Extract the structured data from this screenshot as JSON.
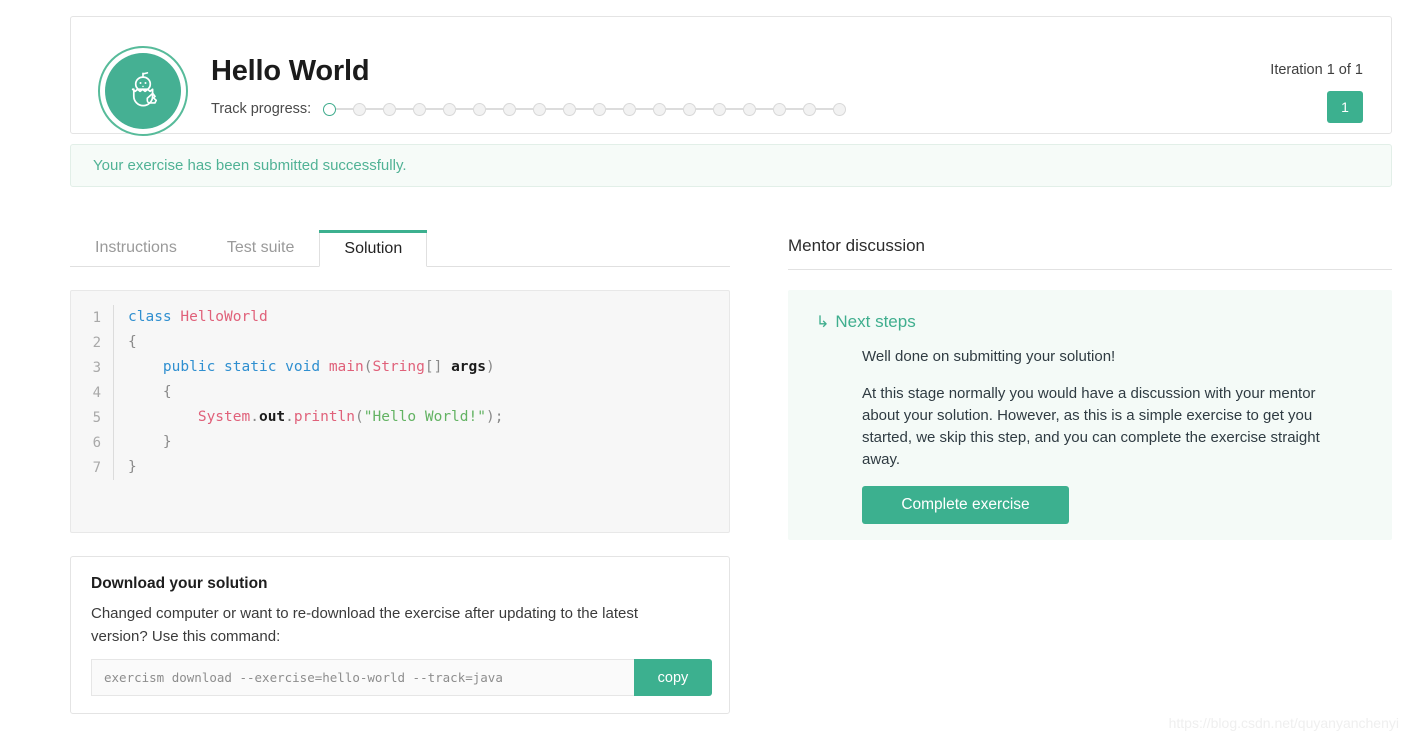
{
  "header": {
    "logo_icon": "hatching-chick-icon",
    "title": "Hello World",
    "track_progress_label": "Track progress:",
    "progress_total_dots": 18,
    "progress_completed_dots": 1,
    "iteration_label": "Iteration 1 of 1",
    "iteration_badge": "1"
  },
  "flash": {
    "message": "Your exercise has been submitted successfully."
  },
  "tabs": [
    {
      "label": "Instructions",
      "active": false
    },
    {
      "label": "Test suite",
      "active": false
    },
    {
      "label": "Solution",
      "active": true
    }
  ],
  "code": {
    "language": "java",
    "lines": [
      {
        "num": "1",
        "text": "class HelloWorld"
      },
      {
        "num": "2",
        "text": "{"
      },
      {
        "num": "3",
        "text": "    public static void main(String[] args)"
      },
      {
        "num": "4",
        "text": "    {"
      },
      {
        "num": "5",
        "text": "        System.out.println(\"Hello World!\");"
      },
      {
        "num": "6",
        "text": "    }"
      },
      {
        "num": "7",
        "text": "}"
      }
    ],
    "line_numbers": [
      "1",
      "2",
      "3",
      "4",
      "5",
      "6",
      "7"
    ]
  },
  "download": {
    "title": "Download your solution",
    "description": "Changed computer or want to re-download the exercise after updating to the latest version? Use this command:",
    "command": "exercism download --exercise=hello-world --track=java",
    "copy_label": "copy"
  },
  "mentor": {
    "heading": "Mentor discussion",
    "next_steps_arrow": "↳",
    "next_steps_title": "Next steps",
    "paragraph_1": "Well done on submitting your solution!",
    "paragraph_2": "At this stage normally you would have a discussion with your mentor about your solution. However, as this is a simple exercise to get you started, we skip this step, and you can complete the exercise straight away.",
    "complete_button": "Complete exercise"
  },
  "watermark": "https://blog.csdn.net/quyanyanchenyi",
  "colors": {
    "accent_green": "#3cb08f",
    "logo_green": "#45b093",
    "flash_bg": "#f6fbf8",
    "flash_text": "#50b295",
    "mentor_panel_bg": "#f4faf7",
    "code_bg": "#f7f7f7"
  }
}
